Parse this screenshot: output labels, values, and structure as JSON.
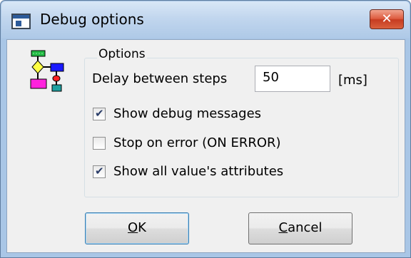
{
  "window": {
    "title": "Debug options",
    "close_glyph": "✕"
  },
  "options": {
    "legend": "Options",
    "delay_label": "Delay between steps",
    "delay_value": "50",
    "delay_unit": "[ms]",
    "checkboxes": [
      {
        "label": "Show debug messages",
        "checked": true
      },
      {
        "label": "Stop on error (ON ERROR)",
        "checked": false
      },
      {
        "label": "Show all value's attributes",
        "checked": true
      }
    ]
  },
  "buttons": {
    "ok_mnemonic": "O",
    "ok_rest": "K",
    "cancel_mnemonic": "C",
    "cancel_rest": "ancel"
  },
  "icons": {
    "app": "window-app-icon",
    "dialog": "flowchart-icon"
  }
}
